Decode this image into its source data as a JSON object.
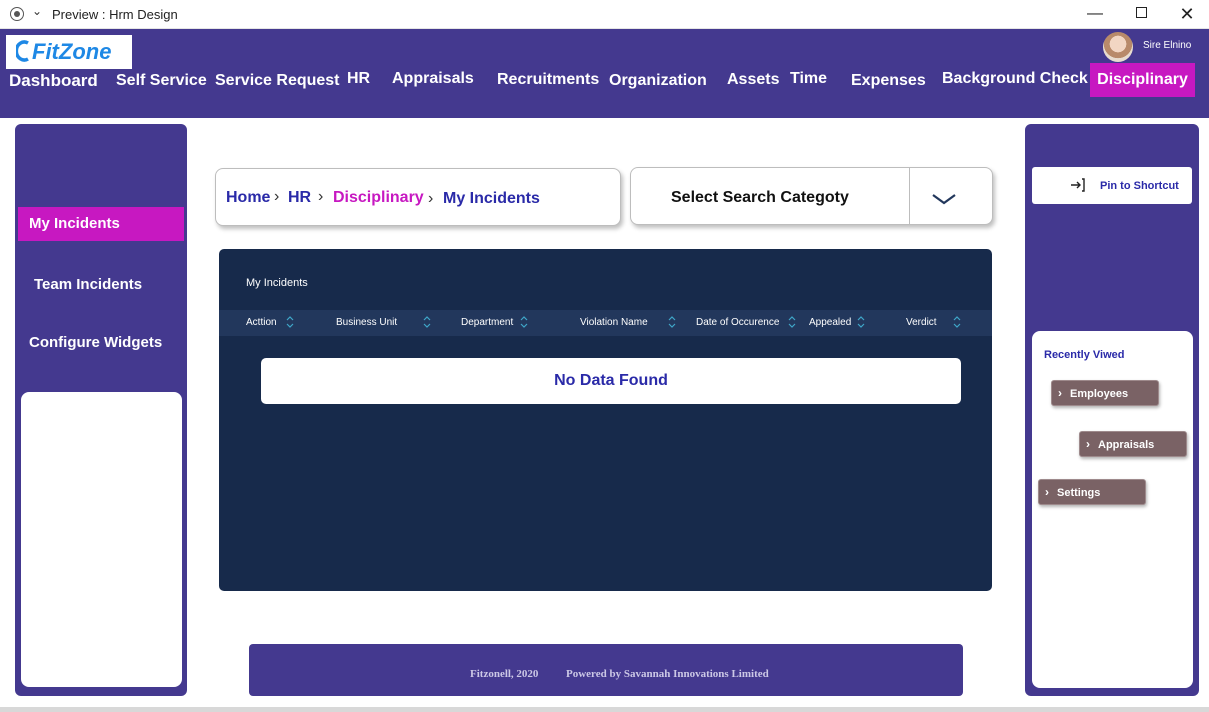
{
  "window": {
    "title": "Preview : Hrm Design",
    "chevron": "⌄",
    "minimize": "—",
    "close": "✕"
  },
  "header": {
    "logo_text": "FitZone",
    "user_name": "Sire Elnino",
    "nav": [
      {
        "label": "Dashboard"
      },
      {
        "label": "Self Service"
      },
      {
        "label": "Service Request"
      },
      {
        "label": "HR"
      },
      {
        "label": "Appraisals"
      },
      {
        "label": "Recruitments"
      },
      {
        "label": "Organization"
      },
      {
        "label": "Assets"
      },
      {
        "label": "Time"
      },
      {
        "label": "Expenses"
      },
      {
        "label": "Background Check"
      },
      {
        "label": "Disciplinary"
      }
    ],
    "active_color": "#c718c1",
    "brand_color": "#44398f"
  },
  "sidebar": {
    "items": [
      {
        "label": "My Incidents"
      },
      {
        "label": "Team Incidents"
      },
      {
        "label": "Configure Widgets"
      }
    ]
  },
  "breadcrumb": {
    "items": [
      {
        "label": "Home"
      },
      {
        "label": "HR"
      },
      {
        "label": "Disciplinary"
      },
      {
        "label": "My Incidents"
      }
    ],
    "separator": "›"
  },
  "search": {
    "label": "Select Search Categoty"
  },
  "table": {
    "title": "My Incidents",
    "columns": [
      {
        "label": "Acttion"
      },
      {
        "label": "Business Unit"
      },
      {
        "label": "Department"
      },
      {
        "label": "Violation Name"
      },
      {
        "label": "Date of Occurence"
      },
      {
        "label": "Appealed"
      },
      {
        "label": "Verdict"
      }
    ],
    "empty_message": "No Data Found"
  },
  "footer": {
    "copyright": "Fitzonell, 2020",
    "powered_by": "Powered by Savannah Innovations Limited"
  },
  "right_panel": {
    "pin_label": "Pin to Shortcut",
    "recent_title": "Recently Viwed",
    "recent_items": [
      {
        "label": "Employees"
      },
      {
        "label": "Appraisals"
      },
      {
        "label": "Settings"
      }
    ],
    "chevron": "›"
  }
}
